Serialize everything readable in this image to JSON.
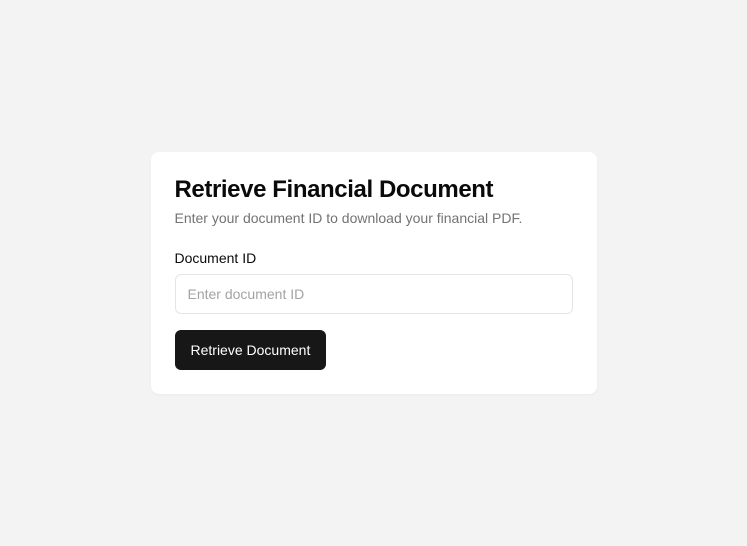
{
  "card": {
    "title": "Retrieve Financial Document",
    "subtitle": "Enter your document ID to download your financial PDF."
  },
  "form": {
    "document_id": {
      "label": "Document ID",
      "placeholder": "Enter document ID",
      "value": ""
    },
    "submit_label": "Retrieve Document"
  }
}
